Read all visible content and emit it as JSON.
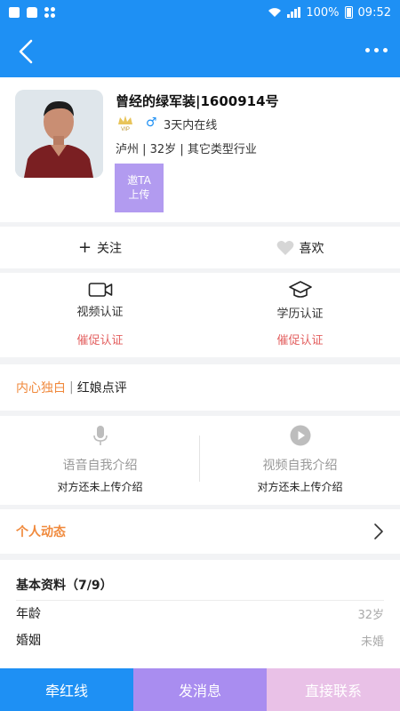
{
  "status_bar": {
    "battery": "100%",
    "time": "09:52"
  },
  "colors": {
    "primary": "#1e90f4",
    "accent_orange": "#f0893c",
    "urge_red": "#e35f5f",
    "purple": "#a98df0",
    "pink": "#e9c1e7"
  },
  "nav": {
    "back_icon": "back-arrow-icon",
    "more_icon": "more-dots-icon"
  },
  "profile": {
    "nickname": "曾经的绿军装|1600914号",
    "vip_badge": "VIP",
    "gender_symbol": "♂",
    "online_status": "3天内在线",
    "meta": "泸州 | 32岁 | 其它类型行业",
    "invite_line1": "邀TA",
    "invite_line2": "上传"
  },
  "actions": {
    "follow_prefix": "+",
    "follow": "关注",
    "like": "喜欢"
  },
  "verify": [
    {
      "icon": "video-camera-icon",
      "label": "视频认证",
      "urge": "催促认证"
    },
    {
      "icon": "graduation-cap-icon",
      "label": "学历认证",
      "urge": "催促认证"
    }
  ],
  "tabs": {
    "first": "内心独白",
    "separator": "|",
    "second": "红娘点评"
  },
  "intro": [
    {
      "icon": "microphone-icon",
      "title": "语音自我介绍",
      "subtitle": "对方还未上传介绍"
    },
    {
      "icon": "play-icon",
      "title": "视频自我介绍",
      "subtitle": "对方还未上传介绍"
    }
  ],
  "dynamics": {
    "label": "个人动态"
  },
  "basic_info": {
    "title": "基本资料（7/9）",
    "rows": [
      {
        "key": "年龄",
        "value": "32岁"
      },
      {
        "key": "婚姻",
        "value": "未婚"
      }
    ]
  },
  "bottom_bar": {
    "matchmaker": "牵红线",
    "message": "发消息",
    "contact": "直接联系"
  }
}
